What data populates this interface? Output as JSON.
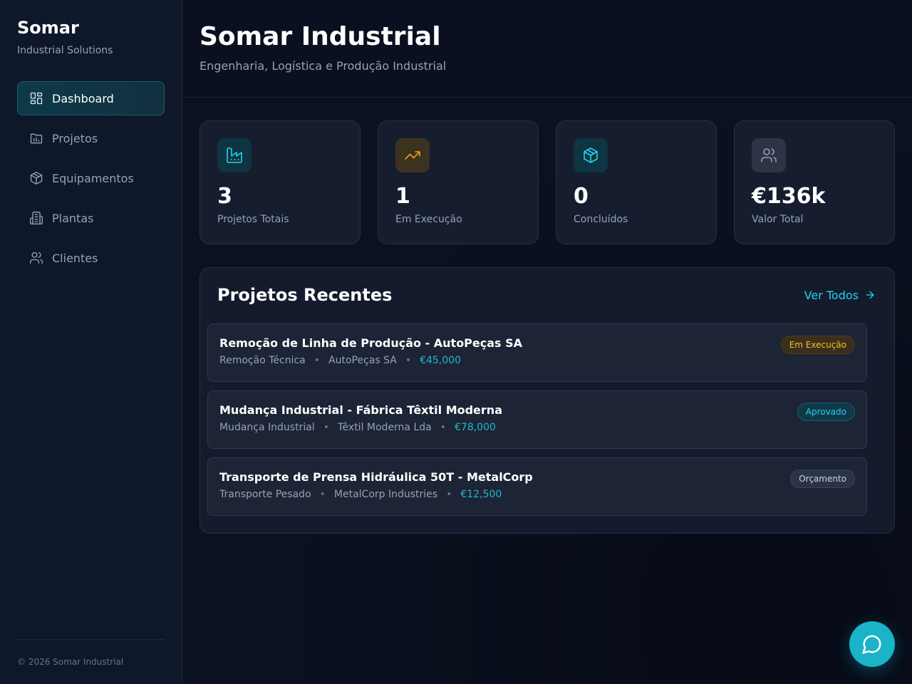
{
  "sidebar": {
    "brand_title": "Somar",
    "brand_subtitle": "Industrial Solutions",
    "items": [
      {
        "label": "Dashboard",
        "icon": "dashboard-icon",
        "active": true
      },
      {
        "label": "Projetos",
        "icon": "projects-icon",
        "active": false
      },
      {
        "label": "Equipamentos",
        "icon": "package-icon",
        "active": false
      },
      {
        "label": "Plantas",
        "icon": "building-icon",
        "active": false
      },
      {
        "label": "Clientes",
        "icon": "users-icon",
        "active": false
      }
    ],
    "footer": "© 2026 Somar Industrial"
  },
  "header": {
    "title": "Somar Industrial",
    "subtitle": "Engenharia, Logística e Produção Industrial"
  },
  "stats": [
    {
      "value": "3",
      "label": "Projetos Totais",
      "icon": "factory-icon",
      "color": "#22d3ee"
    },
    {
      "value": "1",
      "label": "Em Execução",
      "icon": "trending-up-icon",
      "color": "#f59e0b"
    },
    {
      "value": "0",
      "label": "Concluídos",
      "icon": "package-icon",
      "color": "#22d3ee"
    },
    {
      "value": "€136k",
      "label": "Valor Total",
      "icon": "users-icon",
      "color": "#94a3b8"
    }
  ],
  "recent": {
    "title": "Projetos Recentes",
    "view_all": "Ver Todos",
    "projects": [
      {
        "name": "Remoção de Linha de Produção - AutoPeças SA",
        "type": "Remoção Técnica",
        "client": "AutoPeças SA",
        "value": "€45,000",
        "status": "Em Execução"
      },
      {
        "name": "Mudança Industrial - Fábrica Têxtil Moderna",
        "type": "Mudança Industrial",
        "client": "Têxtil Moderna Lda",
        "value": "€78,000",
        "status": "Aprovado"
      },
      {
        "name": "Transporte de Prensa Hidráulica 50T - MetalCorp",
        "type": "Transporte Pesado",
        "client": "MetalCorp Industries",
        "value": "€12,500",
        "status": "Orçamento"
      }
    ]
  },
  "meta_dot": "•",
  "colors": {
    "accent": "#22d3ee",
    "warning": "#fbbf24",
    "background": "#0b1120"
  }
}
